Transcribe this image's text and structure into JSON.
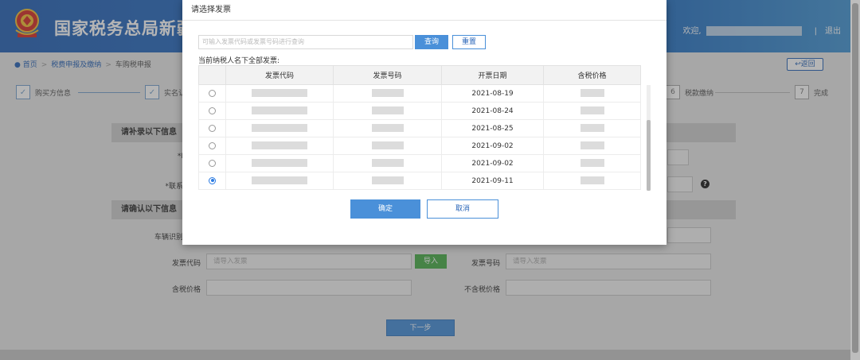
{
  "header": {
    "title": "国家税务总局新疆",
    "welcome": "欢迎,",
    "separator": "|",
    "logout": "退出"
  },
  "breadcrumb": {
    "home": "首页",
    "level1": "税费申报及缴纳",
    "level2": "车购税申报",
    "back": "返回"
  },
  "steps": {
    "s1": "购买方信息",
    "s2": "实名认",
    "s6_num": "6",
    "s6": "税款缴纳",
    "s7_num": "7",
    "s7": "完成"
  },
  "form": {
    "section1": "请补录以下信息",
    "label_a": "*I",
    "label_b": "*联系",
    "section2": "请确认以下信息",
    "vin_label": "车辆识别",
    "invoice_code_label": "发票代码",
    "invoice_code_placeholder": "请导入发票",
    "import": "导入",
    "invoice_no_label": "发票号码",
    "invoice_no_placeholder": "请导入发票",
    "tax_incl_label": "含税价格",
    "tax_excl_label": "不含税价格",
    "help": "?",
    "next": "下一步"
  },
  "dialog": {
    "title": "请选择发票",
    "search_placeholder": "可输入发票代码或发票号码进行查询",
    "query": "查询",
    "reset": "重置",
    "caption": "当前纳税人名下全部发票:",
    "columns": [
      "发票代码",
      "发票号码",
      "开票日期",
      "含税价格"
    ],
    "rows": [
      {
        "date": "2021-08-19",
        "selected": false
      },
      {
        "date": "2021-08-24",
        "selected": false
      },
      {
        "date": "2021-08-25",
        "selected": false
      },
      {
        "date": "2021-09-02",
        "selected": false
      },
      {
        "date": "2021-09-02",
        "selected": false
      },
      {
        "date": "2021-09-11",
        "selected": true
      }
    ],
    "ok": "确定",
    "cancel": "取消"
  },
  "colors": {
    "brand_blue": "#2a66b8",
    "button_blue": "#4a90d9",
    "import_green": "#4cae4c"
  }
}
